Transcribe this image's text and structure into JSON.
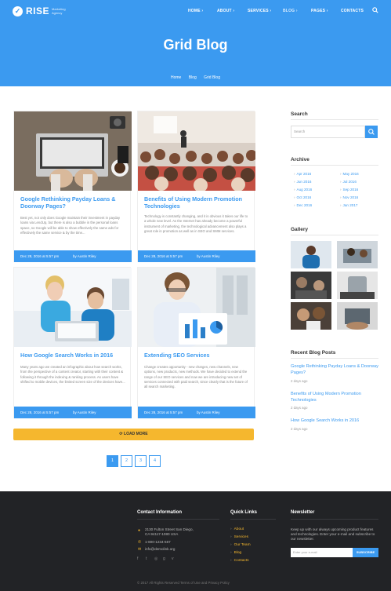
{
  "logo": {
    "name": "RISE",
    "tagline": "Marketing Agency"
  },
  "nav": [
    {
      "label": "HOME",
      "has_dropdown": true
    },
    {
      "label": "ABOUT",
      "has_dropdown": true
    },
    {
      "label": "SERVICES",
      "has_dropdown": true
    },
    {
      "label": "BLOG",
      "has_dropdown": true,
      "active": true
    },
    {
      "label": "PAGES",
      "has_dropdown": true
    },
    {
      "label": "CONTACTS",
      "has_dropdown": false
    }
  ],
  "page_title": "Grid Blog",
  "breadcrumb": [
    "Home",
    "Blog",
    "Grid Blog"
  ],
  "posts": [
    {
      "title": "Google Rethinking Payday Loans & Doorway Pages?",
      "excerpt": "Best yet, not only does Google maintain their investment in payday loans via LendUp, but there is also a bubble in the personal loans space, so Google will be able to show effectively the same ads for effectively the same service & by the time...",
      "date": "Dec 28, 2016 at 5:57 pm",
      "author": "by Austin Riley",
      "image": "laptop-typing-photo"
    },
    {
      "title": "Benefits of Using Modern Promotion Technologies",
      "excerpt": "Technology is constantly changing, and it is obvious it takes our life to a whole new level. As the Internet has already become a powerful instrument of marketing, the technological advancement also plays a great role in promotion as well as in SEO and SMM services.",
      "date": "Dec 28, 2016 at 5:57 pm",
      "author": "by Austin Riley",
      "image": "conference-audience-photo"
    },
    {
      "title": "How Google Search Works in 2016",
      "excerpt": "Many years ago we created an infographic about how search works, from the perspective of a content creator, starting with their content & following it through the indexing & ranking process. As users have shifted to mobile devices, the limited screen size of the devices have...",
      "date": "Dec 28, 2016 at 5:57 pm",
      "author": "by Austin Riley",
      "image": "two-people-laptop-photo"
    },
    {
      "title": "Extending SEO Services",
      "excerpt": "Change creates opportunity - new charges, new channels, new options, new products, new methods. We have decided to extend the range of our SEO services and now we are introducing new set of services connected with paid search, since clearly that is the future of all search marketing.",
      "date": "Dec 28, 2016 at 5:57 pm",
      "author": "by Austin Riley",
      "image": "woman-with-charts-photo"
    }
  ],
  "load_more_label": "LOAD MORE",
  "pagination": [
    "1",
    "2",
    "3",
    "4"
  ],
  "sidebar": {
    "search_heading": "Search",
    "search_placeholder": "Search",
    "archive_heading": "Archive",
    "archive": [
      "Apr 2016",
      "May 2016",
      "Jun 2016",
      "Jul 2016",
      "Aug 2016",
      "Sep 2016",
      "Oct 2016",
      "Nov 2016",
      "Dec 2016",
      "Jan 2017"
    ],
    "gallery_heading": "Gallery",
    "recent_heading": "Recent Blog Posts",
    "recent": [
      {
        "title": "Google Rethinking Payday Loans & Doorway Pages?",
        "ago": "2 days ago"
      },
      {
        "title": "Benefits of Using Modern Promotion Technologies",
        "ago": "2 days ago"
      },
      {
        "title": "How Google Search Works in 2016",
        "ago": "2 days ago"
      }
    ]
  },
  "footer": {
    "contact_heading": "Contact Information",
    "address_line1": "2130 Fulton Street San Diego,",
    "address_line2": "CA 94117-1080 USA",
    "phone": "1-800-1234-567",
    "email": "info@demolink.org",
    "quick_heading": "Quick Links",
    "quick_links": [
      "About",
      "Services",
      "Our Team",
      "Blog",
      "Contacts"
    ],
    "newsletter_heading": "Newsletter",
    "newsletter_text": "Keep up with our always upcoming product features and technologies. Enter your e-mail and subscribe to our newsletter.",
    "newsletter_placeholder": "Enter your e-mail",
    "subscribe_label": "SUBSCRIBE",
    "copyright": "© 2017 All Rights Reserved Terms of Use and Privacy Policy"
  },
  "colors": {
    "primary": "#3b9af0",
    "accent": "#f5b72e",
    "footer_bg": "#222326"
  }
}
